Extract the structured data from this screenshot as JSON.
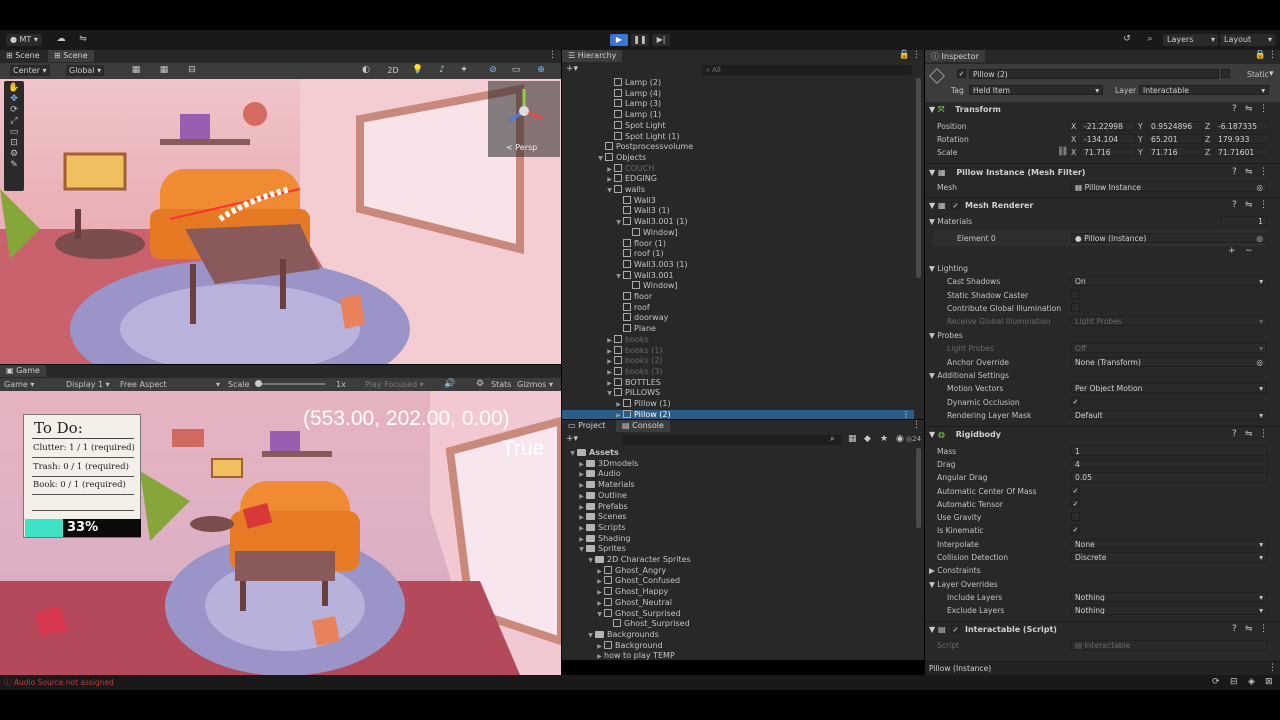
{
  "topbar": {
    "account": "MT",
    "layers": "Layers",
    "layout": "Layout"
  },
  "scene": {
    "tabs": [
      "Scene",
      "Scene"
    ],
    "pivot": "Center",
    "space": "Global",
    "mode2d": "2D",
    "persp": "< Persp"
  },
  "game": {
    "tab": "Game",
    "view": "Game",
    "display": "Display 1",
    "aspect": "Free Aspect",
    "scale_label": "Scale",
    "scale_value": "1x",
    "play_focused": "Play Focused",
    "stats": "Stats",
    "gizmos": "Gizmos",
    "coords": "(553.00, 202.00, 0.00)",
    "flag": "True",
    "todo_title": "To Do:",
    "todo": [
      "Clutter: 1 / 1 (required)",
      "Trash: 0 / 1 (required)",
      "Book: 0 / 1 (required)"
    ],
    "progress_text": "33%",
    "progress_value": 0.33
  },
  "hierarchy": {
    "tab": "Hierarchy",
    "search": "All",
    "items": [
      {
        "t": "Lamp (2)",
        "d": 3,
        "ic": "cube"
      },
      {
        "t": "Lamp (4)",
        "d": 3,
        "ic": "cube"
      },
      {
        "t": "Lamp (3)",
        "d": 3,
        "ic": "cube"
      },
      {
        "t": "Lamp (1)",
        "d": 3,
        "ic": "cube"
      },
      {
        "t": "Spot Light",
        "d": 3,
        "ic": "cube"
      },
      {
        "t": "Spot Light (1)",
        "d": 3,
        "ic": "cube"
      },
      {
        "t": "Postprocessvolume",
        "d": 2,
        "ic": "cube"
      },
      {
        "t": "Objects",
        "d": 2,
        "ic": "cube",
        "exp": "▼"
      },
      {
        "t": "COUCH",
        "d": 3,
        "ic": "cube",
        "exp": "▶",
        "dim": true
      },
      {
        "t": "EDGING",
        "d": 3,
        "ic": "cube",
        "exp": "▶"
      },
      {
        "t": "walls",
        "d": 3,
        "ic": "cube",
        "exp": "▼"
      },
      {
        "t": "Wall3",
        "d": 4,
        "ic": "cube"
      },
      {
        "t": "Wall3 (1)",
        "d": 4,
        "ic": "cube"
      },
      {
        "t": "Wall3.001 (1)",
        "d": 4,
        "ic": "cube",
        "exp": "▼"
      },
      {
        "t": "Window]",
        "d": 5,
        "ic": "cube"
      },
      {
        "t": "floor (1)",
        "d": 4,
        "ic": "cube"
      },
      {
        "t": "roof (1)",
        "d": 4,
        "ic": "cube"
      },
      {
        "t": "Wall3.003 (1)",
        "d": 4,
        "ic": "cube"
      },
      {
        "t": "Wall3.001",
        "d": 4,
        "ic": "cube",
        "exp": "▼"
      },
      {
        "t": "Window]",
        "d": 5,
        "ic": "cube"
      },
      {
        "t": "floor",
        "d": 4,
        "ic": "cube"
      },
      {
        "t": "roof",
        "d": 4,
        "ic": "cube"
      },
      {
        "t": "doorway",
        "d": 4,
        "ic": "cube"
      },
      {
        "t": "Plane",
        "d": 4,
        "ic": "cube"
      },
      {
        "t": "books",
        "d": 3,
        "ic": "cube",
        "exp": "▶",
        "dim": true
      },
      {
        "t": "books (1)",
        "d": 3,
        "ic": "cube",
        "exp": "▶",
        "dim": true
      },
      {
        "t": "books (2)",
        "d": 3,
        "ic": "cube",
        "exp": "▶",
        "dim": true
      },
      {
        "t": "books (3)",
        "d": 3,
        "ic": "cube",
        "exp": "▶",
        "dim": true
      },
      {
        "t": "BOTTLES",
        "d": 3,
        "ic": "cube",
        "exp": "▶"
      },
      {
        "t": "PILLOWS",
        "d": 3,
        "ic": "cube",
        "exp": "▼"
      },
      {
        "t": "Pillow (1)",
        "d": 4,
        "ic": "cube",
        "exp": "▶"
      },
      {
        "t": "Pillow (2)",
        "d": 4,
        "ic": "cube",
        "exp": "▶",
        "sel": true
      }
    ]
  },
  "project": {
    "tabs": [
      "Project",
      "Console"
    ],
    "count": "24",
    "items": [
      {
        "t": "Assets",
        "d": 0,
        "exp": "▼",
        "ic": "folder",
        "bold": true
      },
      {
        "t": "3Dmodels",
        "d": 1,
        "exp": "▶",
        "ic": "folder"
      },
      {
        "t": "Audio",
        "d": 1,
        "exp": "▶",
        "ic": "folder"
      },
      {
        "t": "Materials",
        "d": 1,
        "exp": "▶",
        "ic": "folder"
      },
      {
        "t": "Outline",
        "d": 1,
        "exp": "▶",
        "ic": "folder"
      },
      {
        "t": "Prefabs",
        "d": 1,
        "exp": "▶",
        "ic": "folder"
      },
      {
        "t": "Scenes",
        "d": 1,
        "exp": "▶",
        "ic": "folder"
      },
      {
        "t": "Scripts",
        "d": 1,
        "exp": "▶",
        "ic": "folder"
      },
      {
        "t": "Shading",
        "d": 1,
        "exp": "▶",
        "ic": "folder"
      },
      {
        "t": "Sprites",
        "d": 1,
        "exp": "▼",
        "ic": "folder"
      },
      {
        "t": "2D Character Sprites",
        "d": 2,
        "exp": "▼",
        "ic": "folder"
      },
      {
        "t": "Ghost_Angry",
        "d": 3,
        "exp": "▶",
        "ic": "sprite"
      },
      {
        "t": "Ghost_Confused",
        "d": 3,
        "exp": "▶",
        "ic": "sprite"
      },
      {
        "t": "Ghost_Happy",
        "d": 3,
        "exp": "▶",
        "ic": "sprite"
      },
      {
        "t": "Ghost_Neutral",
        "d": 3,
        "exp": "▶",
        "ic": "sprite"
      },
      {
        "t": "Ghost_Surprised",
        "d": 3,
        "exp": "▼",
        "ic": "sprite"
      },
      {
        "t": "Ghost_Surprised",
        "d": 4,
        "ic": "sprite"
      },
      {
        "t": "Backgrounds",
        "d": 2,
        "exp": "▼",
        "ic": "folder"
      },
      {
        "t": "Background",
        "d": 3,
        "exp": "▶",
        "ic": "sprite"
      },
      {
        "t": "how to play TEMP",
        "d": 3,
        "exp": "▶",
        "ic": "none"
      }
    ]
  },
  "inspector": {
    "tab": "Inspector",
    "name": "Pillow (2)",
    "static": "Static",
    "tag_label": "Tag",
    "tag": "Held Item",
    "layer_label": "Layer",
    "layer": "Interactable",
    "transform": {
      "title": "Transform",
      "pos_label": "Position",
      "rot_label": "Rotation",
      "scale_label": "Scale",
      "position": [
        "-21.22998",
        "0.9524896",
        "-6.187335"
      ],
      "rotation": [
        "-134.104",
        "65.201",
        "179.933"
      ],
      "scale": [
        "71.716",
        "71.716",
        "71.71601"
      ]
    },
    "meshfilter": {
      "title": "Pillow Instance (Mesh Filter)",
      "mesh_label": "Mesh",
      "mesh": "Pillow Instance"
    },
    "renderer": {
      "title": "Mesh Renderer",
      "materials": "Materials",
      "mat_count": "1",
      "element": "Element 0",
      "element_value": "Pillow (Instance)",
      "lighting": "Lighting",
      "cast_label": "Cast Shadows",
      "cast": "On",
      "static_caster": "Static Shadow Caster",
      "contrib_gi": "Contribute Global Illumination",
      "receive_gi": "Receive Global Illumination",
      "receive_gi_value": "Light Probes",
      "probes": "Probes",
      "light_probes": "Light Probes",
      "light_probes_value": "Off",
      "anchor": "Anchor Override",
      "anchor_value": "None (Transform)",
      "additional": "Additional Settings",
      "motion": "Motion Vectors",
      "motion_value": "Per Object Motion",
      "dyn_occ": "Dynamic Occlusion",
      "rlm": "Rendering Layer Mask",
      "rlm_value": "Default"
    },
    "rigidbody": {
      "title": "Rigidbody",
      "mass_label": "Mass",
      "mass": "1",
      "drag_label": "Drag",
      "drag": "4",
      "adrag_label": "Angular Drag",
      "adrag": "0.05",
      "auto_com": "Automatic Center Of Mass",
      "auto_tensor": "Automatic Tensor",
      "gravity": "Use Gravity",
      "kinematic": "Is Kinematic",
      "interp_label": "Interpolate",
      "interp": "None",
      "coll_label": "Collision Detection",
      "coll": "Discrete",
      "constraints": "Constraints",
      "overrides": "Layer Overrides",
      "include_label": "Include Layers",
      "include": "Nothing",
      "exclude_label": "Exclude Layers",
      "exclude": "Nothing"
    },
    "script": {
      "title": "Interactable (Script)",
      "script_label": "Script",
      "script_value": "Interactable"
    },
    "footer": "Pillow (Instance)"
  },
  "status": {
    "message": "Audio Source not assigned"
  },
  "colors": {
    "accent": "#2c5d87",
    "play": "#3b76d6",
    "progress": "#3de3c4",
    "error": "#c23b3b"
  }
}
